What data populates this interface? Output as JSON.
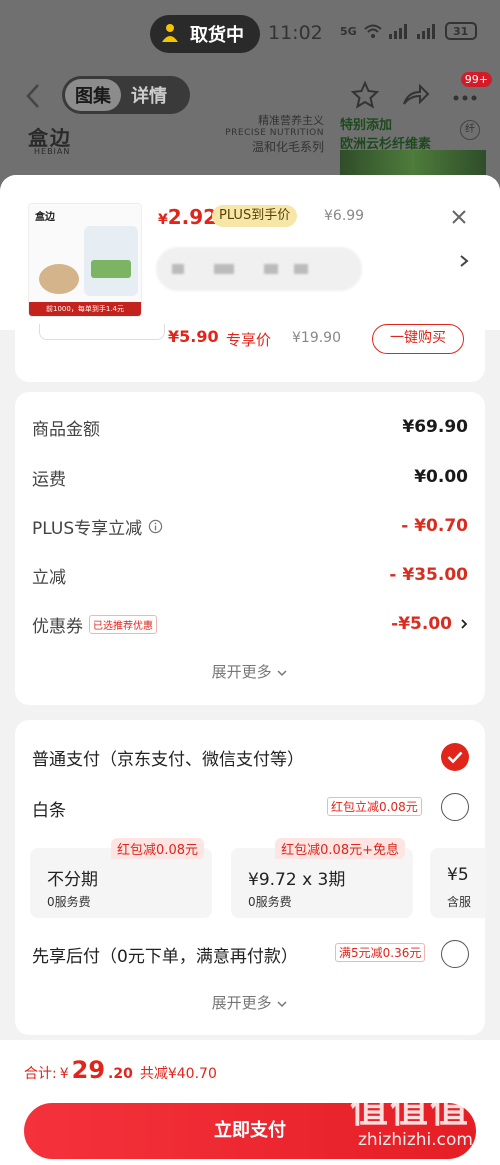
{
  "status_bar": {
    "pickup_label": "取货中",
    "time": "11:02",
    "network": "5G",
    "battery": "31"
  },
  "nav": {
    "tabs": [
      "图集",
      "详情"
    ],
    "cart_badge": "99+"
  },
  "banner": {
    "logo": "盒边",
    "logo_sub": "HEBIAN",
    "line1": "精准营养主义",
    "line2": "PRECISE NUTRITION",
    "line3": "温和化毛系列",
    "right_line1": "特别添加",
    "right_line2": "欧洲云杉纤维素",
    "right_badge": "纤"
  },
  "product": {
    "thumb_brand": "盒边",
    "thumb_strip": "前1000，每单到手1.4元",
    "price_symbol": "¥",
    "price": "2.92",
    "plus_tag": "PLUS到手价",
    "orig_price": "¥6.99"
  },
  "member_offer": {
    "price": "¥5.90",
    "label": "专享价",
    "orig": "¥19.90",
    "buy_label": "一键购买"
  },
  "amounts": {
    "rows": [
      {
        "label": "商品金额",
        "value": "¥69.90"
      },
      {
        "label": "运费",
        "value": "¥0.00"
      },
      {
        "label": "PLUS专享立减",
        "value": "- ¥0.70"
      },
      {
        "label": "立减",
        "value": "- ¥35.00"
      },
      {
        "label": "优惠券",
        "value": "-¥5.00"
      }
    ],
    "coupon_tag": "已选推荐优惠",
    "expand_label": "展开更多"
  },
  "payments": {
    "normal_label": "普通支付（京东支付、微信支付等）",
    "baitiao_label": "白条",
    "baitiao_tag": "红包立减0.08元",
    "plans": [
      {
        "tag": "红包减0.08元",
        "main": "不分期",
        "sub": "0服务费"
      },
      {
        "tag": "红包减0.08元+免息",
        "main": "¥9.72 x 3期",
        "sub": "0服务费"
      },
      {
        "tag": "",
        "main": "¥5",
        "sub": "含服"
      }
    ],
    "xiang_label": "先享后付（0元下单，满意再付款）",
    "xiang_tag": "满5元减0.36元",
    "expand_label": "展开更多"
  },
  "bottom": {
    "total_label": "合计:",
    "total_symbol": "¥",
    "total_int": "29",
    "total_dec": ".20",
    "save_label": "共减¥40.70",
    "pay_button": "立即支付"
  },
  "watermark": {
    "glyphs": "值值值",
    "url": "zhizhizhi.com"
  },
  "colors": {
    "accent_red": "#e1251b",
    "plus_gold": "#f6e7a9"
  }
}
